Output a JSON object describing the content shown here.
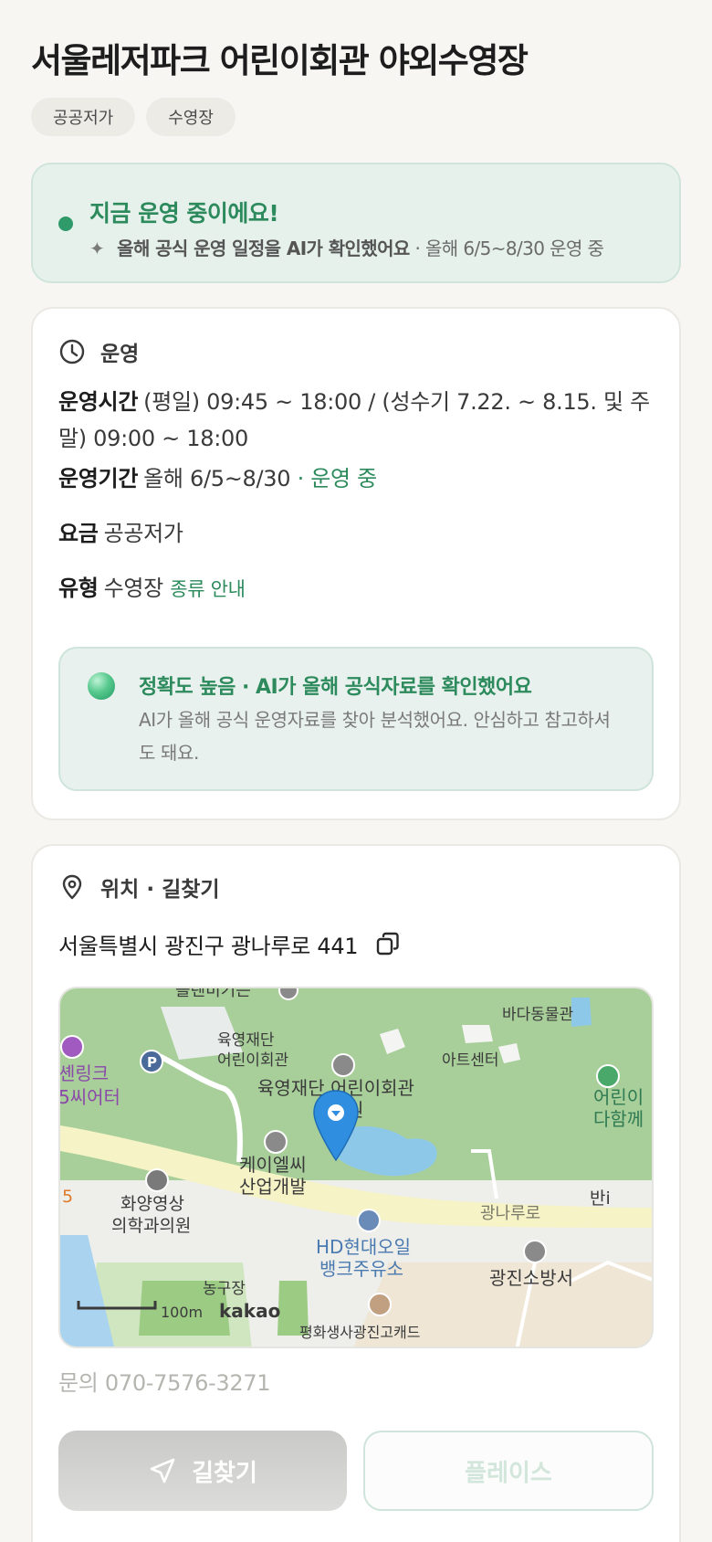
{
  "title": "서울레저파크 어린이회관 야외수영장",
  "tags": [
    "공공저가",
    "수영장"
  ],
  "status": {
    "title": "지금 운영 중이에요!",
    "sub_bold": "올해 공식 운영 일정을 AI가 확인했어요",
    "sub_rest": " · 올해 6/5~8/30 운영 중",
    "accent": "#2c8a5c"
  },
  "operation": {
    "section_label": "운영",
    "hours_label": "운영시간",
    "hours_value": "(평일) 09:45 ~ 18:00 / (성수기 7.22. ~ 8.15. 및 주말) 09:00 ~ 18:00",
    "period_label": "운영기간",
    "period_value": "올해 6/5~8/30",
    "period_status": " · 운영 중",
    "fee_label": "요금",
    "fee_value": "공공저가",
    "type_label": "유형",
    "type_value": "수영장",
    "type_link": "종류 안내"
  },
  "ai_box": {
    "title": "정확도 높음 · AI가 올해 공식자료를 확인했어요",
    "text": "AI가 올해 공식 운영자료를 찾아 분석했어요. 안심하고 참고하셔도 돼요."
  },
  "location": {
    "section_label": "위치 · 길찾기",
    "address": "서울특별시 광진구 광나루로 441",
    "copy_icon": "copy-icon"
  },
  "map": {
    "labels": {
      "top_cut": "플렌비기쁜",
      "sea_animal": "바다동물관",
      "yj_small1": "육영재단",
      "yj_small2": "어린이회관",
      "art_center": "아트센터",
      "yj_big": "육영재단 어린이회관",
      "yj_big2": "원",
      "left_cut1": "셴링크",
      "left_cut2": "5씨어터",
      "right_cut1": "어린이",
      "right_cut2": "다함께",
      "kel1": "케이엘씨",
      "kel2": "산업개발",
      "clinic1": "화양영상",
      "clinic2": "의학과의원",
      "num_cut": "5",
      "road": "광나루로",
      "right_cut3": "반i",
      "oil1": "HD현대오일",
      "oil2": "뱅크주유소",
      "fire": "광진소방서",
      "court": "농구장",
      "scale": "100m",
      "brand": "kakao",
      "bottom_cut": "평화생사광진고캐드"
    }
  },
  "contact": "문의 070-7576-3271",
  "buttons": {
    "route": "길찾기",
    "place": "플레이스"
  }
}
